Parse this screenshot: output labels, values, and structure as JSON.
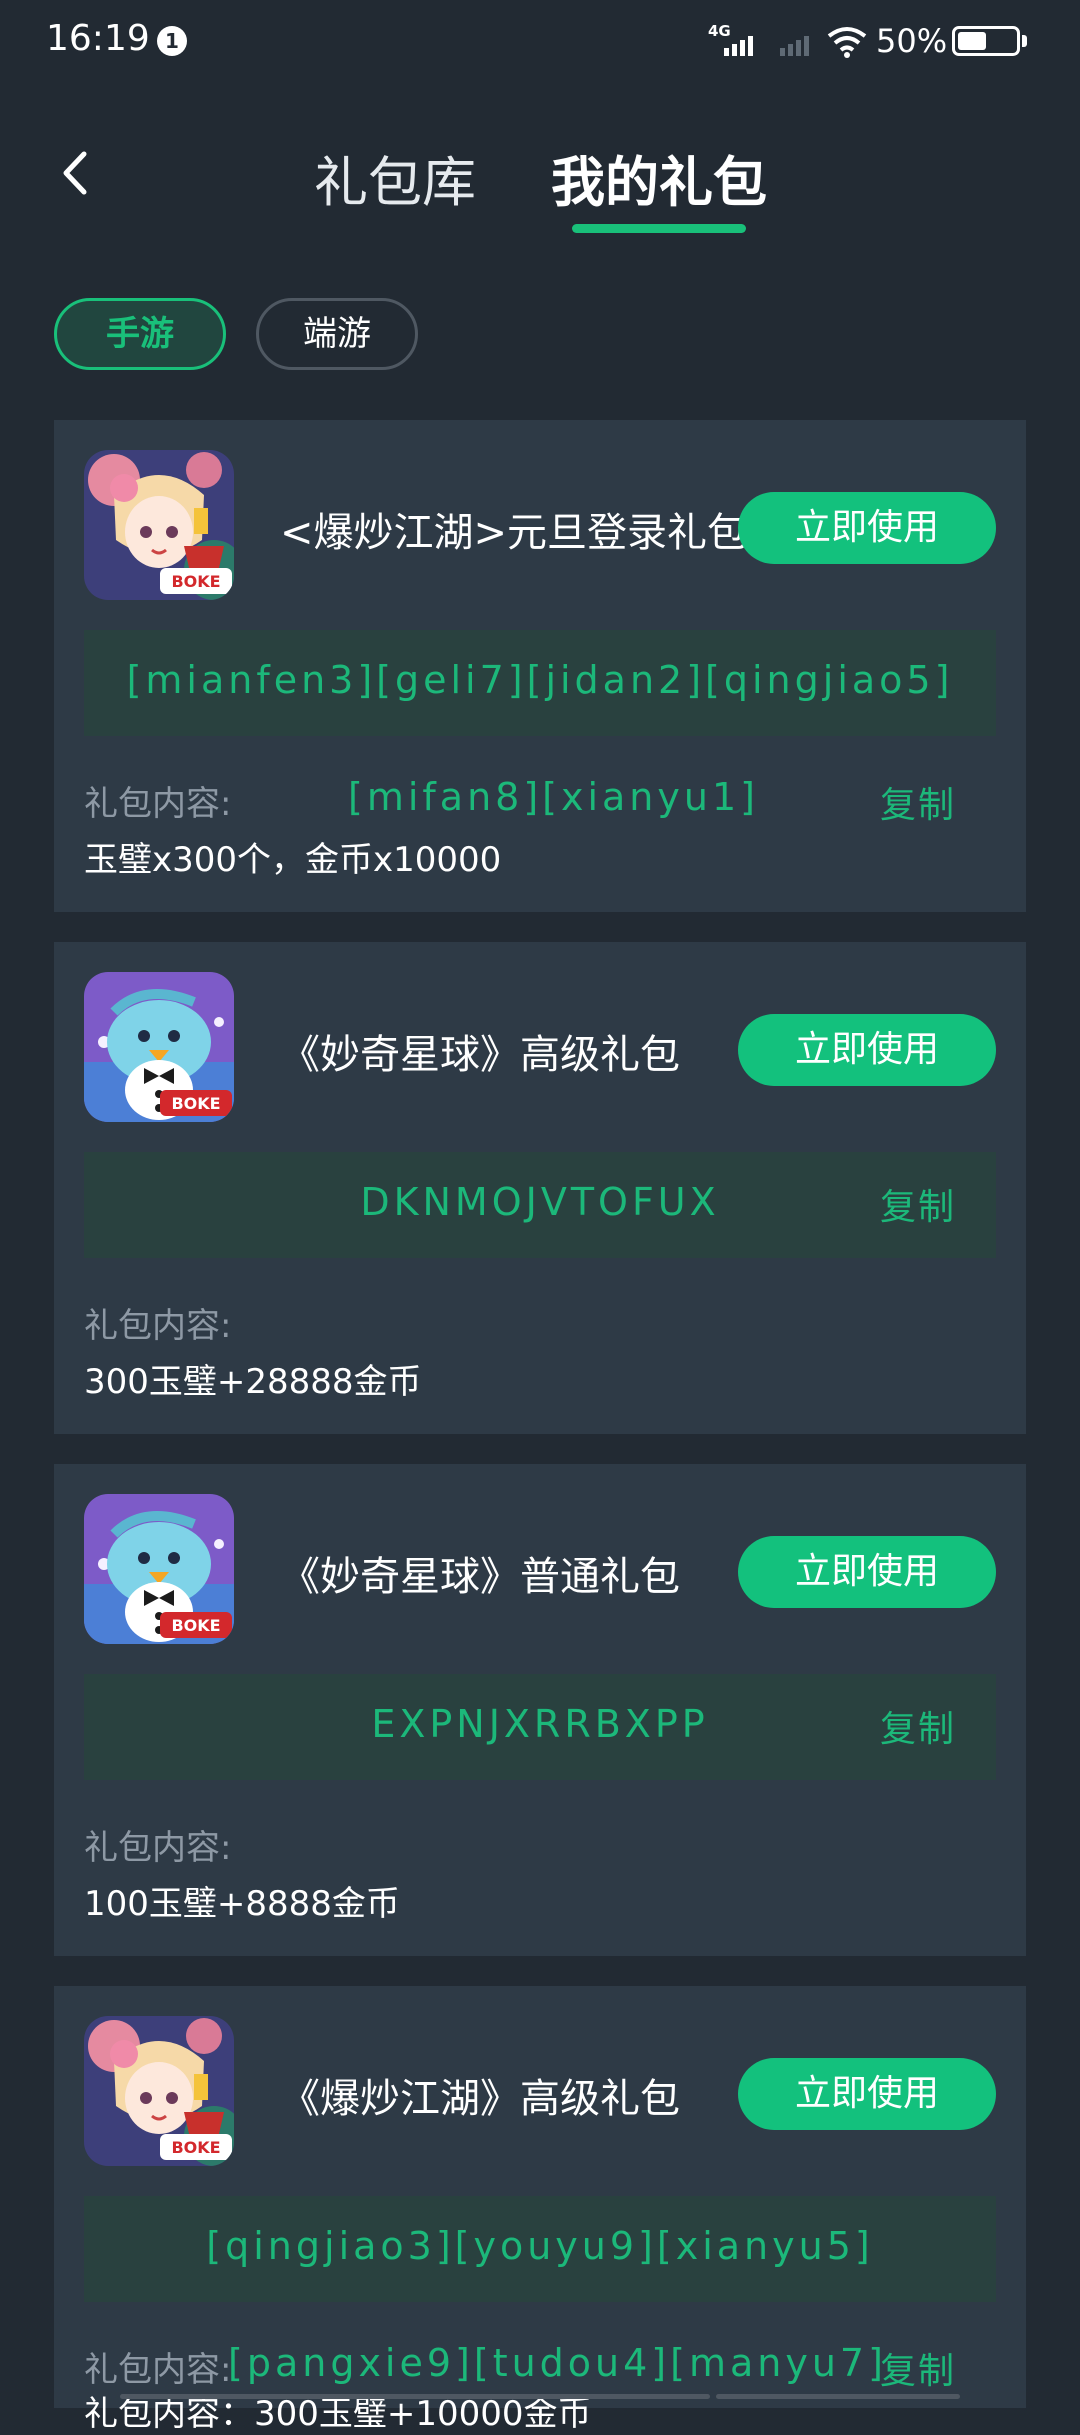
{
  "status_bar": {
    "time": "16:19",
    "notification_count": "1",
    "network": "4G",
    "battery_percent": "50%",
    "battery_level": 0.5
  },
  "nav": {
    "back_icon": "chevron-left-icon",
    "tabs": [
      {
        "label": "礼包库"
      },
      {
        "label": "我的礼包"
      }
    ],
    "active_tab": 1
  },
  "filters": [
    {
      "label": "手游",
      "selected": true
    },
    {
      "label": "端游",
      "selected": false
    }
  ],
  "colors": {
    "accent": "#13c17d",
    "background": "#222a33",
    "card": "#2e3a46",
    "code_box": "#29413f",
    "code_text": "#1cb87a"
  },
  "gifts": [
    {
      "icon": "baochao-jianghu-game-icon",
      "title": "<爆炒江湖>元旦登录礼包",
      "use_label": "立即使用",
      "code": "[mianfen3][geli7][jidan2][qingjiao5]",
      "code_overflow": "[mifan8][xianyu1]",
      "copy_label": "复制",
      "content_label": "礼包内容:",
      "content": "玉璧x300个，金币x10000"
    },
    {
      "icon": "miaoqi-xingqiu-game-icon",
      "title": "《妙奇星球》高级礼包",
      "use_label": "立即使用",
      "code": "DKNMOJVTOFUX",
      "copy_label": "复制",
      "content_label": "礼包内容:",
      "content": "300玉璧+28888金币"
    },
    {
      "icon": "miaoqi-xingqiu-game-icon",
      "title": "《妙奇星球》普通礼包",
      "use_label": "立即使用",
      "code": "EXPNJXRRBXPP",
      "copy_label": "复制",
      "content_label": "礼包内容:",
      "content": "100玉璧+8888金币"
    },
    {
      "icon": "baochao-jianghu-game-icon",
      "title": "《爆炒江湖》高级礼包",
      "use_label": "立即使用",
      "code": "[qingjiao3][youyu9][xianyu5]",
      "code_overflow": "[pangxie9][tudou4][manyu7]",
      "copy_label": "复制",
      "content_label": "礼包内容:",
      "content": "礼包内容：300玉璧+10000金币"
    }
  ]
}
